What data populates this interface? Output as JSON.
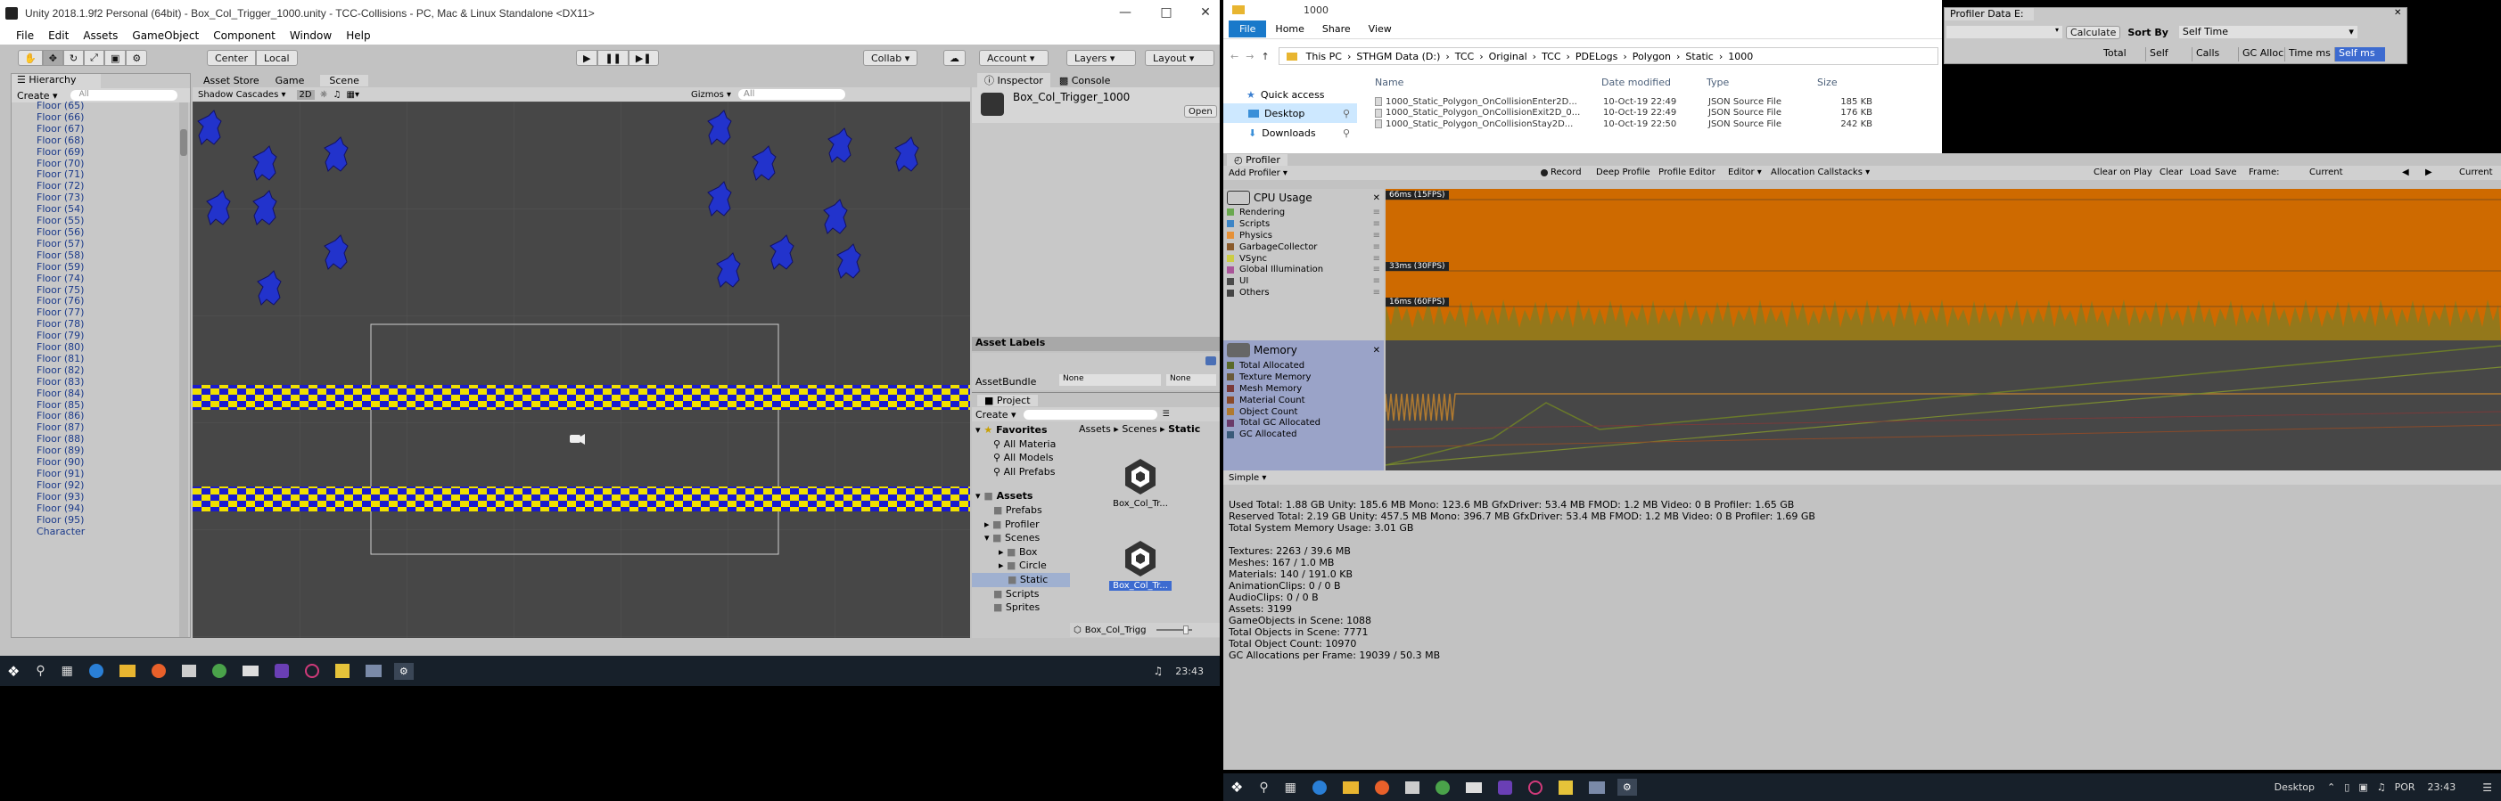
{
  "unity": {
    "title": "Unity 2018.1.9f2 Personal (64bit) - Box_Col_Trigger_1000.unity - TCC-Collisions - PC, Mac & Linux Standalone <DX11>",
    "menu": [
      "File",
      "Edit",
      "Assets",
      "GameObject",
      "Component",
      "Window",
      "Help"
    ],
    "toolbar": {
      "center": "Center",
      "local": "Local",
      "collab": "Collab",
      "account": "Account",
      "layers": "Layers",
      "layout": "Layout"
    },
    "hierarchy": {
      "tab": "Hierarchy",
      "create": "Create",
      "search_placeholder": "All",
      "items": [
        "Floor (65)",
        "Floor (66)",
        "Floor (67)",
        "Floor (68)",
        "Floor (69)",
        "Floor (70)",
        "Floor (71)",
        "Floor (72)",
        "Floor (73)",
        "Floor (54)",
        "Floor (55)",
        "Floor (56)",
        "Floor (57)",
        "Floor (58)",
        "Floor (59)",
        "Floor (74)",
        "Floor (75)",
        "Floor (76)",
        "Floor (77)",
        "Floor (78)",
        "Floor (79)",
        "Floor (80)",
        "Floor (81)",
        "Floor (82)",
        "Floor (83)",
        "Floor (84)",
        "Floor (85)",
        "Floor (86)",
        "Floor (87)",
        "Floor (88)",
        "Floor (89)",
        "Floor (90)",
        "Floor (91)",
        "Floor (92)",
        "Floor (93)",
        "Floor (94)",
        "Floor (95)",
        "Character"
      ]
    },
    "scene_tabs": [
      "Asset Store",
      "Game",
      "Scene"
    ],
    "scene_bar": {
      "shading": "Shadow Cascades",
      "mode": "2D",
      "gizmos": "Gizmos",
      "search_placeholder": "All"
    },
    "inspector": {
      "tab": "Inspector",
      "console": "Console",
      "object": "Box_Col_Trigger_1000",
      "open": "Open"
    },
    "asset_labels": {
      "title": "Asset Labels",
      "bundle_label": "AssetBundle",
      "bundle_value": "None",
      "variant_value": "None"
    },
    "project": {
      "tab": "Project",
      "create": "Create",
      "favorites": "Favorites",
      "fav_items": [
        "All Materia",
        "All Models",
        "All Prefabs"
      ],
      "assets": "Assets",
      "asset_folders": [
        "Prefabs",
        "Profiler",
        "Scenes",
        "Box",
        "Circle",
        "Static",
        "Scripts",
        "Sprites"
      ],
      "breadcrumb": [
        "Assets",
        "Scenes",
        "Static"
      ],
      "files": [
        "Box_Col_Tr...",
        "Box_Col_Tr..."
      ],
      "selected": "Box_Col_Trigg"
    },
    "taskbar": {
      "clock": "23:43"
    }
  },
  "explorer": {
    "title": "1000",
    "ribbon": [
      "File",
      "Home",
      "Share",
      "View"
    ],
    "path": [
      "This PC",
      "STHGM Data (D:)",
      "TCC",
      "Original",
      "TCC",
      "PDELogs",
      "Polygon",
      "Static",
      "1000"
    ],
    "nav": [
      "Quick access",
      "Desktop",
      "Downloads"
    ],
    "columns": [
      "Name",
      "Date modified",
      "Type",
      "Size"
    ],
    "files": [
      {
        "name": "1000_Static_Polygon_OnCollisionEnter2D...",
        "date": "10-Oct-19 22:49",
        "type": "JSON Source File",
        "size": "185 KB"
      },
      {
        "name": "1000_Static_Polygon_OnCollisionExit2D_0...",
        "date": "10-Oct-19 22:49",
        "type": "JSON Source File",
        "size": "176 KB"
      },
      {
        "name": "1000_Static_Polygon_OnCollisionStay2D...",
        "date": "10-Oct-19 22:50",
        "type": "JSON Source File",
        "size": "242 KB"
      }
    ]
  },
  "profiler_data": {
    "title": "Profiler Data E:",
    "calculate": "Calculate",
    "sort_by": "Sort By",
    "sort_value": "Self Time",
    "columns": [
      "Total",
      "Self",
      "Calls",
      "GC Alloc",
      "Time ms",
      "Self ms"
    ]
  },
  "profiler": {
    "tab": "Profiler",
    "add": "Add Profiler",
    "toolbar": [
      "Record",
      "Deep Profile",
      "Profile Editor",
      "Editor",
      "Allocation Callstacks"
    ],
    "right_toolbar": [
      "Clear on Play",
      "Clear",
      "Load",
      "Save"
    ],
    "frame_label": "Frame:",
    "frame_value": "Current",
    "current": "Current",
    "cpu": {
      "title": "CPU Usage",
      "items": [
        {
          "name": "Rendering",
          "color": "#6aa84f"
        },
        {
          "name": "Scripts",
          "color": "#3d85c6"
        },
        {
          "name": "Physics",
          "color": "#e69138"
        },
        {
          "name": "GarbageCollector",
          "color": "#8a5a2b"
        },
        {
          "name": "VSync",
          "color": "#cccc44"
        },
        {
          "name": "Global Illumination",
          "color": "#aa5599"
        },
        {
          "name": "UI",
          "color": "#4a4a4a"
        },
        {
          "name": "Others",
          "color": "#444444"
        }
      ],
      "markers": [
        "66ms (15FPS)",
        "33ms (30FPS)",
        "16ms (60FPS)"
      ]
    },
    "memory": {
      "title": "Memory",
      "items": [
        {
          "name": "Total Allocated",
          "color": "#5a6a2a"
        },
        {
          "name": "Texture Memory",
          "color": "#6a5a3a"
        },
        {
          "name": "Mesh Memory",
          "color": "#7a3a3a"
        },
        {
          "name": "Material Count",
          "color": "#8a4a2a"
        },
        {
          "name": "Object Count",
          "color": "#b07a30"
        },
        {
          "name": "Total GC Allocated",
          "color": "#6a3a6a"
        },
        {
          "name": "GC Allocated",
          "color": "#3a5a7a"
        }
      ]
    },
    "mode": "Simple",
    "stats": [
      "Used Total: 1.88 GB   Unity: 185.6 MB   Mono: 123.6 MB   GfxDriver: 53.4 MB   FMOD: 1.2 MB   Video: 0 B   Profiler: 1.65 GB",
      "Reserved Total: 2.19 GB   Unity: 457.5 MB   Mono: 396.7 MB   GfxDriver: 53.4 MB   FMOD: 1.2 MB   Video: 0 B   Profiler: 1.69 GB",
      "Total System Memory Usage: 3.01 GB",
      "",
      "Textures: 2263 / 39.6 MB",
      "Meshes: 167 / 1.0 MB",
      "Materials: 140 / 191.0 KB",
      "AnimationClips: 0 / 0 B",
      "AudioClips: 0 / 0 B",
      "Assets: 3199",
      "GameObjects in Scene: 1088",
      "Total Objects in Scene: 7771",
      "Total Object Count: 10970",
      "GC Allocations per Frame: 19039 / 50.3 MB"
    ]
  },
  "taskbar2": {
    "desktop": "Desktop",
    "lang": "POR",
    "clock": "23:43"
  }
}
